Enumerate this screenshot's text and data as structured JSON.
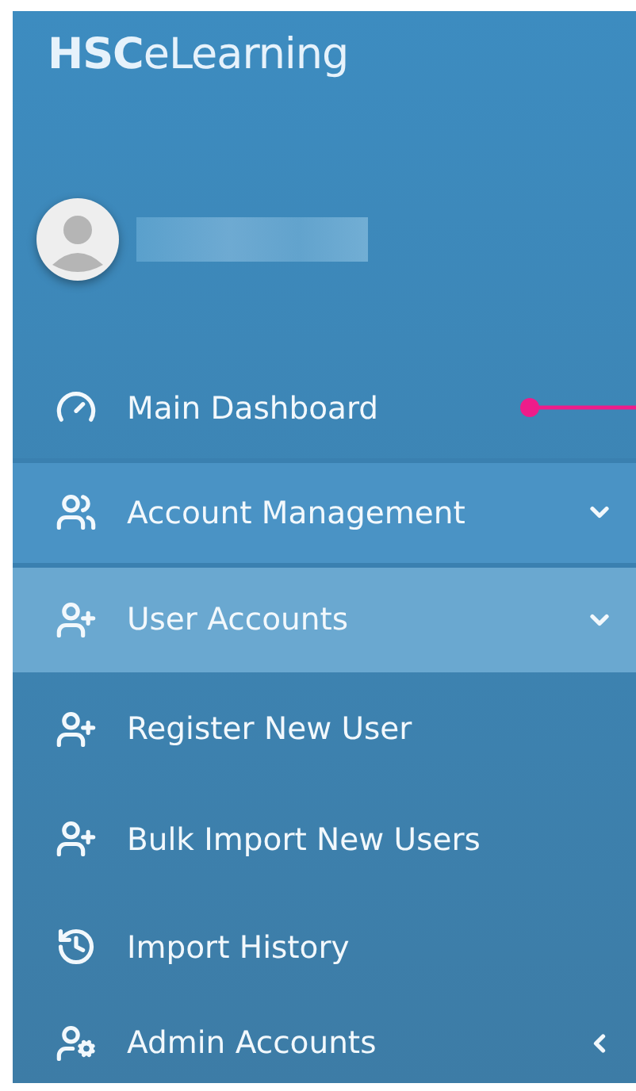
{
  "brand": "**HSC**eLearning",
  "menu": [
    {
      "label": "Main Dashboard",
      "selected": false
    },
    {
      "label": "Account Management",
      "expanded": true,
      "selected": false,
      "children": [
        {
          "label": "User Accounts",
          "expanded": true,
          "selected": true,
          "children": [
            {
              "label": "Register New User",
              "selected": false
            },
            {
              "label": "Bulk Import New Users",
              "selected": false
            },
            {
              "label": "Import History",
              "selected": false
            }
          ]
        },
        {
          "label": "Admin Accounts",
          "expanded": false,
          "selected": false
        }
      ]
    }
  ]
}
